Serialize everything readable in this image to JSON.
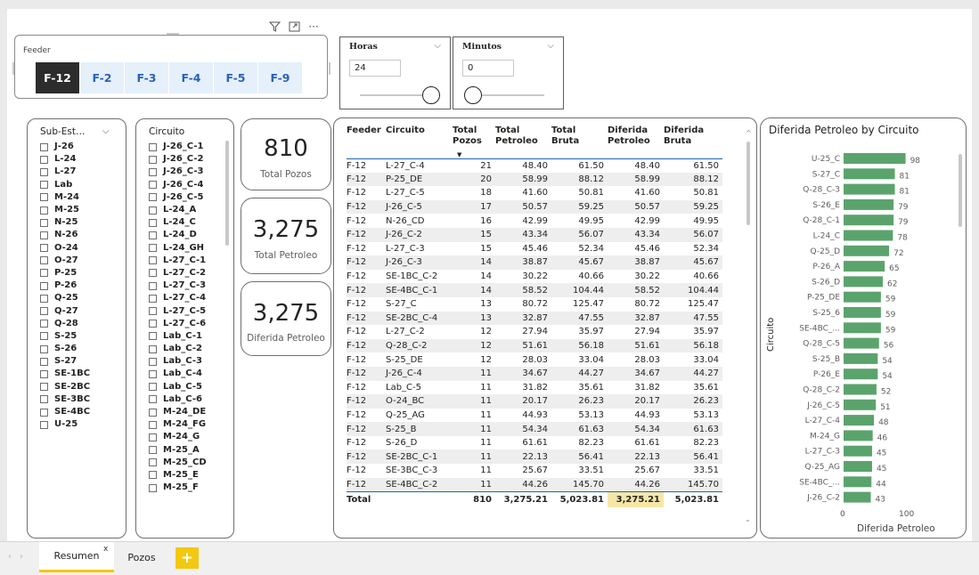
{
  "colors": {
    "accent": "#f2c811",
    "bar": "#5ba36c",
    "tile_selected": "#2c2c2c",
    "tile_text": "#2a62b8",
    "tile_bg": "#e6f0fb",
    "header_line": "#1e66ad"
  },
  "visual_header_icons": [
    "filter-icon",
    "focus-mode-icon",
    "more-options-icon"
  ],
  "feeder": {
    "label": "Feeder",
    "tiles": [
      "F-12",
      "F-2",
      "F-3",
      "F-4",
      "F-5",
      "F-9"
    ],
    "selected": "F-12"
  },
  "horas": {
    "title": "Horas",
    "value": "24",
    "slider_fraction": 1.0
  },
  "minutos": {
    "title": "Minutos",
    "value": "0",
    "slider_fraction": 0.0
  },
  "sub_estacion": {
    "header": "Sub-Est…",
    "items": [
      "J-26",
      "L-24",
      "L-27",
      "Lab",
      "M-24",
      "M-25",
      "N-25",
      "N-26",
      "O-24",
      "O-27",
      "P-25",
      "P-26",
      "Q-25",
      "Q-27",
      "Q-28",
      "S-25",
      "S-26",
      "S-27",
      "SE-1BC",
      "SE-2BC",
      "SE-3BC",
      "SE-4BC",
      "U-25"
    ]
  },
  "circuito": {
    "header": "Circuito",
    "items": [
      "J-26_C-1",
      "J-26_C-2",
      "J-26_C-3",
      "J-26_C-4",
      "J-26_C-5",
      "L-24_A",
      "L-24_C",
      "L-24_D",
      "L-24_GH",
      "L-27_C-1",
      "L-27_C-2",
      "L-27_C-3",
      "L-27_C-4",
      "L-27_C-5",
      "L-27_C-6",
      "Lab_C-1",
      "Lab_C-2",
      "Lab_C-3",
      "Lab_C-4",
      "Lab_C-5",
      "Lab_C-6",
      "M-24_DE",
      "M-24_FG",
      "M-24_G",
      "M-25_A",
      "M-25_CD",
      "M-25_E",
      "M-25_F"
    ]
  },
  "kpis": [
    {
      "value": "810",
      "label": "Total Pozos"
    },
    {
      "value": "3,275",
      "label": "Total Petroleo"
    },
    {
      "value": "3,275",
      "label": "Diferida Petroleo"
    }
  ],
  "table": {
    "columns": [
      "Feeder",
      "Circuito",
      "Total Pozos",
      "Total Petroleo",
      "Total Bruta",
      "Diferida Petroleo",
      "Diferida Bruta"
    ],
    "rows": [
      [
        "F-12",
        "L-27_C-4",
        "21",
        "48.40",
        "61.50",
        "48.40",
        "61.50"
      ],
      [
        "F-12",
        "P-25_DE",
        "20",
        "58.99",
        "88.12",
        "58.99",
        "88.12"
      ],
      [
        "F-12",
        "L-27_C-5",
        "18",
        "41.60",
        "50.81",
        "41.60",
        "50.81"
      ],
      [
        "F-12",
        "J-26_C-5",
        "17",
        "50.57",
        "59.25",
        "50.57",
        "59.25"
      ],
      [
        "F-12",
        "N-26_CD",
        "16",
        "42.99",
        "49.95",
        "42.99",
        "49.95"
      ],
      [
        "F-12",
        "J-26_C-2",
        "15",
        "43.34",
        "56.07",
        "43.34",
        "56.07"
      ],
      [
        "F-12",
        "L-27_C-3",
        "15",
        "45.46",
        "52.34",
        "45.46",
        "52.34"
      ],
      [
        "F-12",
        "J-26_C-3",
        "14",
        "38.87",
        "45.67",
        "38.87",
        "45.67"
      ],
      [
        "F-12",
        "SE-1BC_C-2",
        "14",
        "30.22",
        "40.66",
        "30.22",
        "40.66"
      ],
      [
        "F-12",
        "SE-4BC_C-1",
        "14",
        "58.52",
        "104.44",
        "58.52",
        "104.44"
      ],
      [
        "F-12",
        "S-27_C",
        "13",
        "80.72",
        "125.47",
        "80.72",
        "125.47"
      ],
      [
        "F-12",
        "SE-2BC_C-4",
        "13",
        "32.87",
        "47.55",
        "32.87",
        "47.55"
      ],
      [
        "F-12",
        "L-27_C-2",
        "12",
        "27.94",
        "35.97",
        "27.94",
        "35.97"
      ],
      [
        "F-12",
        "Q-28_C-2",
        "12",
        "51.61",
        "56.18",
        "51.61",
        "56.18"
      ],
      [
        "F-12",
        "S-25_DE",
        "12",
        "28.03",
        "33.04",
        "28.03",
        "33.04"
      ],
      [
        "F-12",
        "J-26_C-4",
        "11",
        "34.67",
        "44.27",
        "34.67",
        "44.27"
      ],
      [
        "F-12",
        "Lab_C-5",
        "11",
        "31.82",
        "35.61",
        "31.82",
        "35.61"
      ],
      [
        "F-12",
        "O-24_BC",
        "11",
        "20.17",
        "26.23",
        "20.17",
        "26.23"
      ],
      [
        "F-12",
        "Q-25_AG",
        "11",
        "44.93",
        "53.13",
        "44.93",
        "53.13"
      ],
      [
        "F-12",
        "S-25_B",
        "11",
        "54.34",
        "61.63",
        "54.34",
        "61.63"
      ],
      [
        "F-12",
        "S-26_D",
        "11",
        "61.61",
        "82.23",
        "61.61",
        "82.23"
      ],
      [
        "F-12",
        "SE-2BC_C-1",
        "11",
        "22.13",
        "56.41",
        "22.13",
        "56.41"
      ],
      [
        "F-12",
        "SE-3BC_C-3",
        "11",
        "25.67",
        "33.51",
        "25.67",
        "33.51"
      ],
      [
        "F-12",
        "SE-4BC_C-2",
        "11",
        "44.26",
        "145.70",
        "44.26",
        "145.70"
      ]
    ],
    "total": [
      "Total",
      "",
      "810",
      "3,275.21",
      "5,023.81",
      "3,275.21",
      "5,023.81"
    ]
  },
  "chart_data": {
    "type": "bar",
    "orientation": "horizontal",
    "title": "Diferida Petroleo by Circuito",
    "xlabel": "Diferida Petroleo",
    "ylabel": "Circuito",
    "xlim": [
      0,
      100
    ],
    "xticks": [
      "0",
      "100"
    ],
    "categories": [
      "U-25_C",
      "S-27_C",
      "Q-28_C-3",
      "S-26_E",
      "Q-28_C-1",
      "L-24_C",
      "Q-25_D",
      "P-26_A",
      "S-26_D",
      "P-25_DE",
      "S-25_6",
      "SE-4BC_...",
      "Q-28_C-5",
      "S-25_B",
      "P-26_E",
      "Q-28_C-2",
      "J-26_C-5",
      "L-27_C-4",
      "M-24_G",
      "L-27_C-3",
      "Q-25_AG",
      "SE-4BC_...",
      "J-26_C-2"
    ],
    "values": [
      98,
      81,
      81,
      79,
      79,
      78,
      72,
      65,
      62,
      59,
      59,
      59,
      56,
      54,
      54,
      52,
      51,
      48,
      46,
      45,
      45,
      44,
      43
    ],
    "data_labels": [
      "98",
      "81",
      "81",
      "79",
      "79",
      "78",
      "72",
      "65",
      "62",
      "59",
      "59",
      "59",
      "56",
      "54",
      "54",
      "52",
      "51",
      "48",
      "46",
      "45",
      "45",
      "44",
      "43"
    ]
  },
  "tabs": [
    {
      "label": "Resumen",
      "active": true,
      "close": "x"
    },
    {
      "label": "Pozos",
      "active": false
    }
  ],
  "add_tab": "+",
  "nav": {
    "prev": "‹",
    "next": "›"
  }
}
